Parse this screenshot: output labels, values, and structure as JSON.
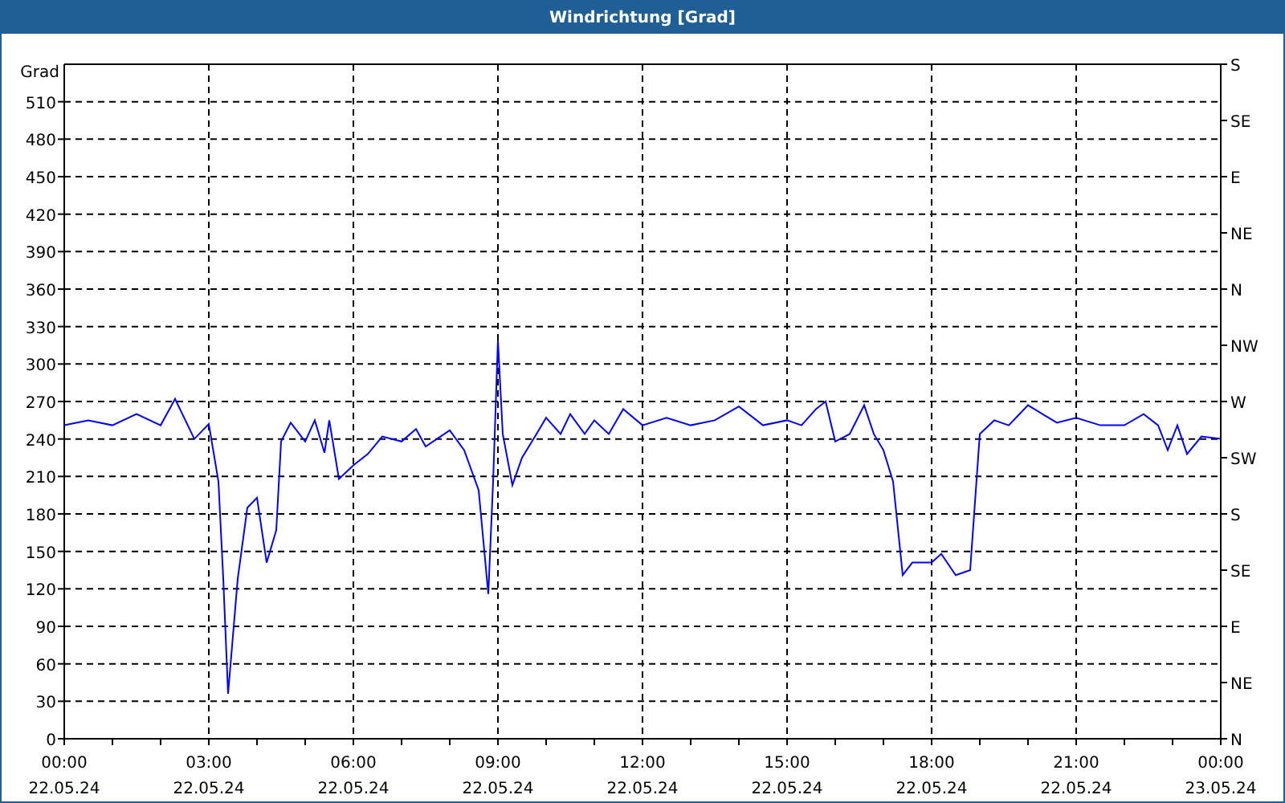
{
  "window": {
    "title": "Windrichtung [Grad]"
  },
  "chart": {
    "right_axis_labels": [
      "S",
      "SE",
      "E",
      "NE",
      "N",
      "NW",
      "W",
      "SW",
      "S",
      "SE",
      "E",
      "NE",
      "N"
    ],
    "x_dates": [
      "22.05.24",
      "22.05.24",
      "22.05.24",
      "22.05.24",
      "22.05.24",
      "22.05.24",
      "22.05.24",
      "22.05.24",
      "23.05.24"
    ],
    "chart_data": {
      "type": "line",
      "grid": true,
      "ylabel": "Grad",
      "xlim": [
        0,
        24
      ],
      "ylim": [
        0,
        540
      ],
      "xticks": [
        {
          "value": 0,
          "label": "00:00"
        },
        {
          "value": 3,
          "label": "03:00"
        },
        {
          "value": 6,
          "label": "06:00"
        },
        {
          "value": 9,
          "label": "09:00"
        },
        {
          "value": 12,
          "label": "12:00"
        },
        {
          "value": 15,
          "label": "15:00"
        },
        {
          "value": 18,
          "label": "18:00"
        },
        {
          "value": 21,
          "label": "21:00"
        },
        {
          "value": 24,
          "label": "00:00"
        }
      ],
      "yticks": [
        0,
        30,
        60,
        90,
        120,
        150,
        180,
        210,
        240,
        270,
        300,
        330,
        360,
        390,
        420,
        450,
        480,
        510
      ],
      "x": [
        0,
        0.5,
        1,
        1.5,
        2,
        2.3,
        2.7,
        3,
        3.2,
        3.3,
        3.4,
        3.6,
        3.8,
        4,
        4.2,
        4.4,
        4.5,
        4.7,
        5,
        5.2,
        5.4,
        5.5,
        5.7,
        6,
        6.3,
        6.6,
        7,
        7.3,
        7.5,
        8,
        8.3,
        8.6,
        8.8,
        8.9,
        9,
        9.1,
        9.3,
        9.5,
        9.8,
        10,
        10.3,
        10.5,
        10.8,
        11,
        11.3,
        11.6,
        12,
        12.5,
        13,
        13.5,
        14,
        14.5,
        15,
        15.3,
        15.6,
        15.8,
        16,
        16.3,
        16.6,
        16.8,
        17,
        17.2,
        17.4,
        17.6,
        18,
        18.2,
        18.5,
        18.8,
        19,
        19.3,
        19.6,
        20,
        20.3,
        20.6,
        21,
        21.5,
        22,
        22.4,
        22.7,
        22.9,
        23.1,
        23.3,
        23.6,
        24
      ],
      "series": [
        {
          "color": "#0000ff",
          "values": [
            251,
            255,
            251,
            260,
            251,
            272,
            240,
            252,
            206,
            128,
            36,
            128,
            185,
            193,
            141,
            167,
            238,
            253,
            238,
            255,
            229,
            255,
            208,
            219,
            228,
            242,
            238,
            248,
            234,
            247,
            231,
            199,
            116,
            206,
            319,
            244,
            203,
            225,
            244,
            257,
            244,
            260,
            244,
            255,
            244,
            264,
            251,
            257,
            251,
            255,
            266,
            251,
            255,
            251,
            264,
            270,
            238,
            244,
            267,
            244,
            231,
            206,
            131,
            141,
            141,
            148,
            131,
            135,
            244,
            255,
            251,
            267,
            260,
            253,
            257,
            251,
            251,
            260,
            251,
            231,
            251,
            228,
            242,
            240
          ]
        }
      ]
    }
  }
}
